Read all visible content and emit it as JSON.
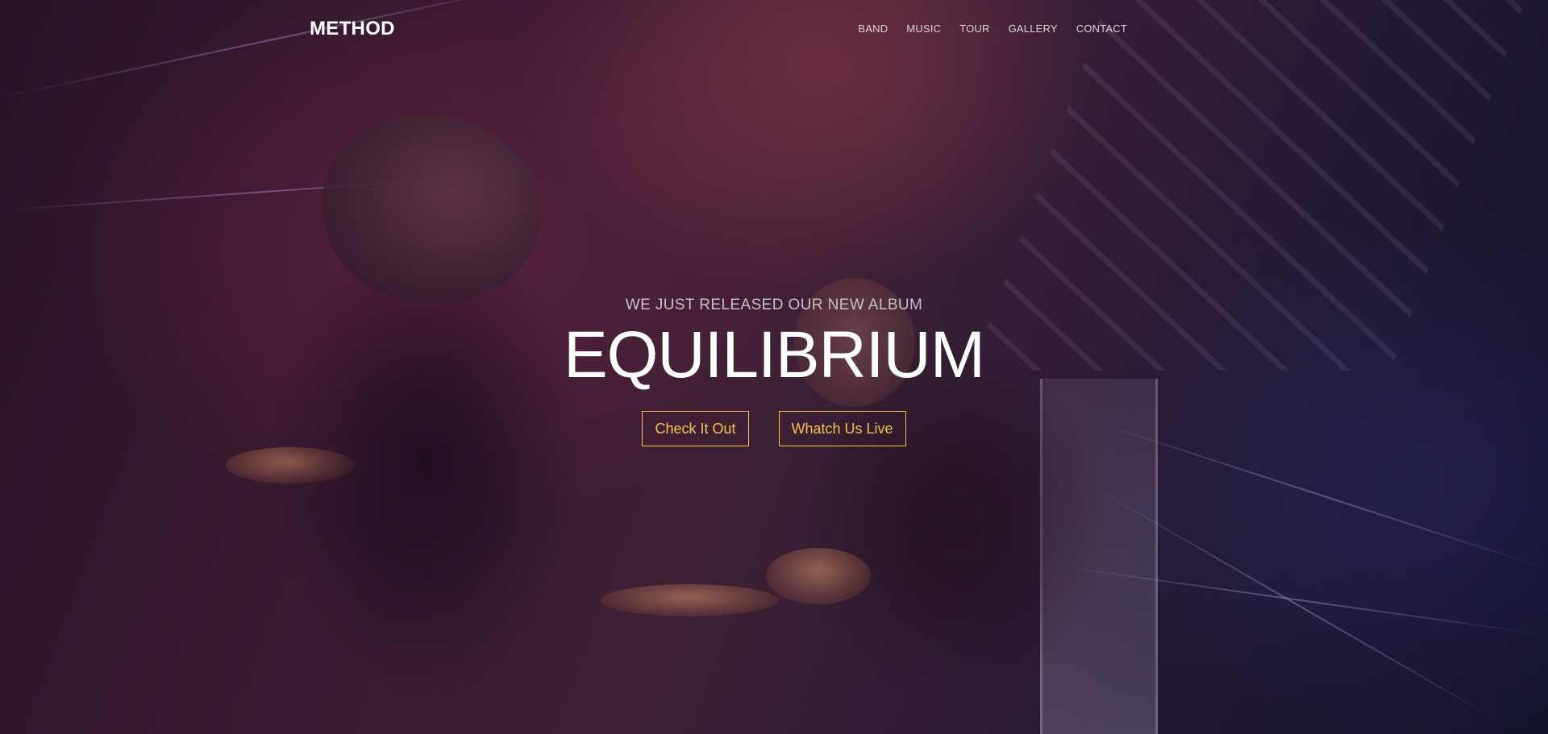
{
  "header": {
    "brand": "METHOD",
    "nav": [
      {
        "label": "BAND"
      },
      {
        "label": "MUSIC"
      },
      {
        "label": "TOUR"
      },
      {
        "label": "GALLERY"
      },
      {
        "label": "CONTACT"
      }
    ]
  },
  "hero": {
    "subtitle": "WE JUST RELEASED OUR NEW ALBUM",
    "title": "EQUILIBRIUM",
    "buttons": [
      {
        "label": "Check It Out"
      },
      {
        "label": "Whatch Us Live"
      }
    ],
    "background": "concert-photo-band-on-stage"
  },
  "colors": {
    "accent": "#f2c14e",
    "text": "#ffffff",
    "muted": "#c8bec9"
  }
}
